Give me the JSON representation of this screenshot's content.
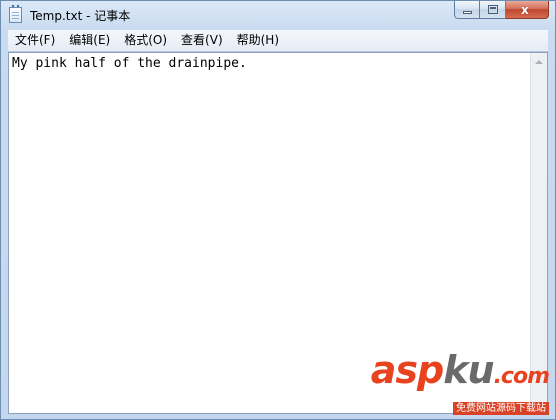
{
  "window": {
    "title": "Temp.txt - 记事本"
  },
  "icons": {
    "app": "notepad-icon",
    "minimize": "minimize-icon",
    "maximize": "maximize-icon",
    "close": "close-icon",
    "scroll_up": "scroll-up-arrow-icon",
    "scroll_down": "scroll-down-arrow-icon"
  },
  "caption": {
    "close_glyph": "x"
  },
  "menu": {
    "items": [
      {
        "label": "文件(F)"
      },
      {
        "label": "编辑(E)"
      },
      {
        "label": "格式(O)"
      },
      {
        "label": "查看(V)"
      },
      {
        "label": "帮助(H)"
      }
    ]
  },
  "editor": {
    "content": "My pink half of the drainpipe."
  },
  "watermark": {
    "logo_prefix": "asp",
    "logo_suffix": "ku",
    "logo_tld": ".com",
    "tagline": "免费网站源码下载站"
  },
  "colors": {
    "window_frame": "#c3d7ee",
    "close_button": "#c0452c",
    "watermark_accent": "#e8421e"
  }
}
